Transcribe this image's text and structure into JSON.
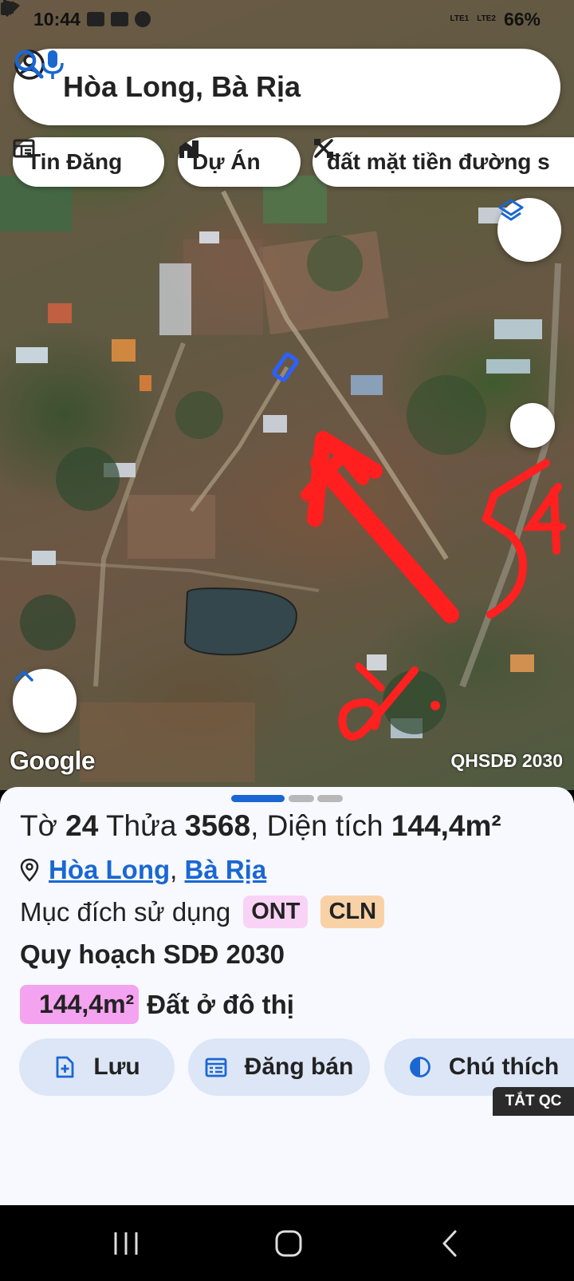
{
  "status_bar": {
    "time": "10:44",
    "net1": "LTE1",
    "net2": "LTE2",
    "battery": "66%"
  },
  "search": {
    "query": "Hòa Long, Bà Rịa"
  },
  "chips": [
    {
      "label": "Tin Đăng",
      "icon": "news-icon"
    },
    {
      "label": "Dự Án",
      "icon": "buildings-icon"
    },
    {
      "label": "đất mặt tiền đường s",
      "icon": "tools-icon"
    }
  ],
  "map": {
    "watermark": "Google",
    "layer_label": "QHSDĐ 2030"
  },
  "parcel": {
    "sheet_prefix": "Tờ",
    "sheet_no": "24",
    "parcel_prefix": "Thửa",
    "parcel_no": "3568",
    "area_prefix": ", Diện tích",
    "area": "144,4m²",
    "ward": "Hòa Long",
    "city": "Bà Rịa",
    "comma": ",",
    "purpose_label": "Mục đích sử dụng",
    "purpose_codes": [
      "ONT",
      "CLN"
    ],
    "badge_colors": [
      "#f9d3f6",
      "#f8d2a6"
    ],
    "plan_title": "Quy hoạch SDĐ 2030",
    "plan_area": "144,4m²",
    "plan_area_color": "#f4a3f0",
    "plan_type": "Đất ở đô thị"
  },
  "actions": {
    "save": "Lưu",
    "post_sale": "Đăng bán",
    "legend": "Chú thích"
  },
  "ad_toggle": "TẮT QC",
  "accent_color": "#1a67d2"
}
